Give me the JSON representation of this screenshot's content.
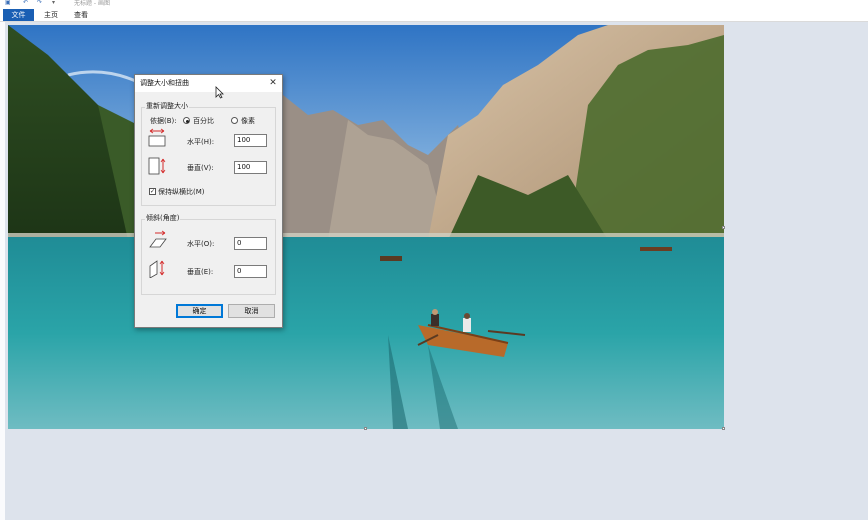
{
  "window": {
    "title": "无标题 - 画图",
    "quick_access_icons": [
      "save-icon",
      "undo-icon",
      "redo-icon",
      "customize-dropdown-icon"
    ]
  },
  "ribbon": {
    "tabs": [
      {
        "label": "文件",
        "active": true
      },
      {
        "label": "主页",
        "active": false
      },
      {
        "label": "查看",
        "active": false
      }
    ]
  },
  "dialog": {
    "title": "调整大小和扭曲",
    "resize": {
      "group_label": "重新调整大小",
      "by_label": "依据(B):",
      "option_percent": "百分比",
      "option_pixels": "像素",
      "selected": "百分比",
      "horizontal_label": "水平(H):",
      "horizontal_value": "100",
      "vertical_label": "垂直(V):",
      "vertical_value": "100",
      "keep_aspect_label": "保持纵横比(M)",
      "keep_aspect_checked": true
    },
    "skew": {
      "group_label": "倾斜(角度)",
      "horizontal_label": "水平(O):",
      "horizontal_value": "0",
      "vertical_label": "垂直(E):",
      "vertical_value": "0"
    },
    "ok_label": "确定",
    "cancel_label": "取消"
  },
  "colors": {
    "file_tab": "#1a5fb4",
    "workspace": "#dde3ec",
    "lake": "#2c8e98",
    "resize_arrow": "#d42a2a"
  }
}
